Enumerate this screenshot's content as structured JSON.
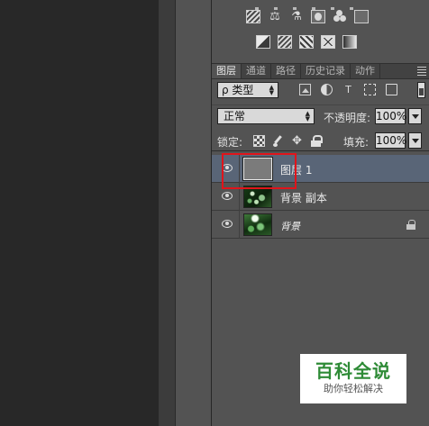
{
  "panels": {
    "layers": {
      "tabs": [
        {
          "label": "图层",
          "active": true
        },
        {
          "label": "通道",
          "active": false
        },
        {
          "label": "路径",
          "active": false
        },
        {
          "label": "历史记录",
          "active": false
        },
        {
          "label": "动作",
          "active": false
        }
      ],
      "filter": {
        "selected": "ρ 类型",
        "icons": [
          "pixel-filter-icon",
          "adjustment-filter-icon",
          "type-filter-icon",
          "shape-filter-icon",
          "smart-object-filter-icon"
        ]
      },
      "blend_mode": "正常",
      "opacity_label": "不透明度:",
      "opacity_value": "100%",
      "lock_label": "锁定:",
      "fill_label": "填充:",
      "fill_value": "100%",
      "layers": [
        {
          "name": "图层 1",
          "visible": true,
          "selected": true,
          "thumbnail": "gray-fill",
          "locked": false
        },
        {
          "name": "背景 副本",
          "visible": true,
          "selected": false,
          "thumbnail": "green-photo",
          "locked": false
        },
        {
          "name": "背景",
          "visible": true,
          "selected": false,
          "thumbnail": "green-photo",
          "locked": true,
          "italic": true
        }
      ]
    }
  },
  "watermark": {
    "title": "百科全说",
    "subtitle": "助你轻松解决"
  },
  "colors": {
    "panel_bg": "#535353",
    "selected_row": "#596577",
    "highlight_box": "#e0141b",
    "watermark_green": "#2e8b36"
  }
}
